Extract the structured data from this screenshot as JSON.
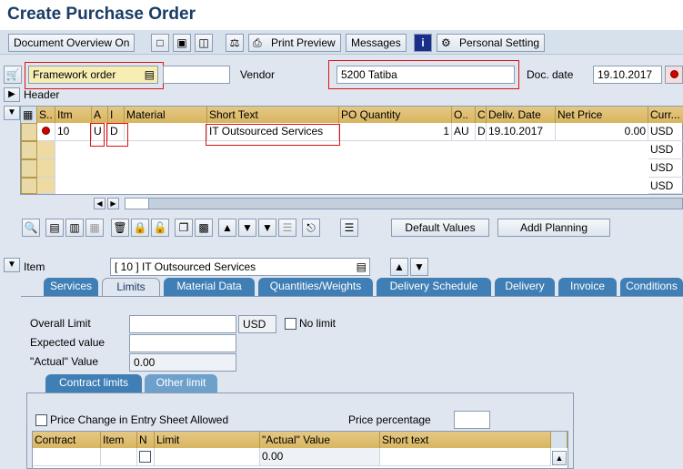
{
  "window": {
    "title": "Create Purchase Order"
  },
  "toolbar": {
    "document_overview": "Document Overview On",
    "print_preview": "Print Preview",
    "messages": "Messages",
    "personal_setting": "Personal Setting"
  },
  "header_fields": {
    "order_type": "Framework order",
    "vendor_label": "Vendor",
    "vendor_value": "5200 Tatiba",
    "doc_date_label": "Doc. date",
    "doc_date_value": "19.10.2017",
    "header_label": "Header"
  },
  "items_table": {
    "columns": [
      "S..",
      "Itm",
      "A",
      "I",
      "Material",
      "Short Text",
      "PO Quantity",
      "O..",
      "C",
      "Deliv. Date",
      "Net Price",
      "Curr..."
    ],
    "rows": [
      {
        "itm": "10",
        "a": "U",
        "i": "D",
        "material": "",
        "short_text": "IT Outsourced Services",
        "qty": "1",
        "o": "AU",
        "c": "D",
        "deliv_date": "19.10.2017",
        "net_price": "0.00",
        "curr": "USD"
      },
      {
        "curr": "USD"
      },
      {
        "curr": "USD"
      },
      {
        "curr": "USD"
      }
    ]
  },
  "item_toolbar": {
    "default_values": "Default Values",
    "addl_planning": "Addl Planning"
  },
  "item_detail": {
    "label": "Item",
    "value": "[ 10 ] IT Outsourced Services"
  },
  "tabs": [
    "Services",
    "Limits",
    "Material Data",
    "Quantities/Weights",
    "Delivery Schedule",
    "Delivery",
    "Invoice",
    "Conditions"
  ],
  "limits": {
    "overall_limit_label": "Overall Limit",
    "overall_limit_value": "",
    "overall_limit_currency": "USD",
    "no_limit_label": "No limit",
    "expected_value_label": "Expected value",
    "expected_value_value": "",
    "actual_value_label": "\"Actual\" Value",
    "actual_value_value": "0.00"
  },
  "subtabs": [
    "Contract limits",
    "Other limit"
  ],
  "contract_limits": {
    "price_change_label": "Price Change in Entry Sheet Allowed",
    "price_percentage_label": "Price percentage",
    "columns": [
      "Contract",
      "Item",
      "N",
      "Limit",
      "\"Actual\" Value",
      "Short text"
    ],
    "row": {
      "actual_value": "0.00"
    }
  },
  "colors": {
    "accent": "#3f7fb5",
    "highlight": "#e01010",
    "title": "#1a3c66"
  }
}
